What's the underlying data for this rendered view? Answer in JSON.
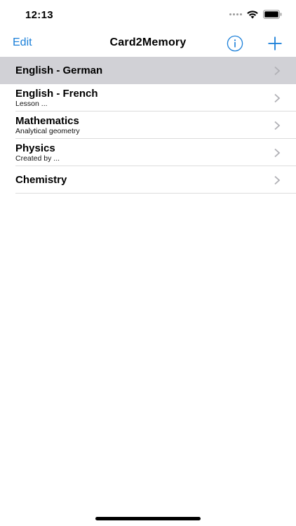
{
  "status_bar": {
    "time": "12:13"
  },
  "nav": {
    "edit_label": "Edit",
    "title": "Card2Memory",
    "info_icon": "info-circle-icon",
    "add_icon": "plus-icon"
  },
  "decks": [
    {
      "title": "English - German",
      "subtitle": "",
      "selected": true
    },
    {
      "title": "English - French",
      "subtitle": "Lesson ..."
    },
    {
      "title": "Mathematics",
      "subtitle": "Analytical geometry"
    },
    {
      "title": "Physics",
      "subtitle": "Created by ..."
    },
    {
      "title": "Chemistry",
      "subtitle": ""
    }
  ],
  "colors": {
    "accent": "#1a7fd9",
    "selected_row": "#d1d1d6",
    "separator": "#dcdcdc",
    "chevron": "#b0b0b5"
  }
}
